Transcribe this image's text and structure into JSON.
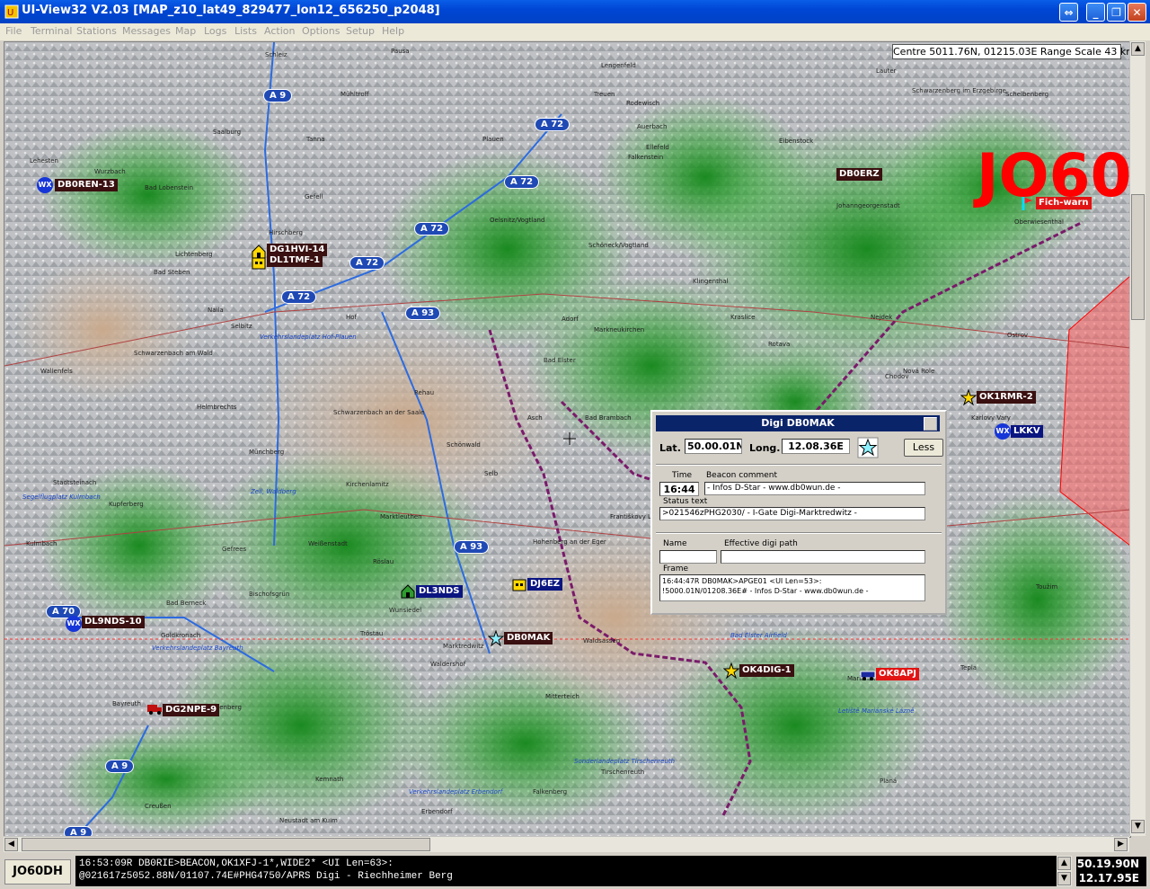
{
  "window": {
    "title": "UI-View32 V2.03 [MAP_z10_lat49_829477_lon12_656250_p2048]"
  },
  "menu": [
    "File",
    "Terminal",
    "Stations",
    "Messages",
    "Map",
    "Logs",
    "Lists",
    "Action",
    "Options",
    "Setup",
    "Help"
  ],
  "map": {
    "info": "Centre 5011.76N, 01215.03E Range Scale 43 km",
    "grid_label": "JO60",
    "roads": [
      "A 9",
      "A 72",
      "A 72",
      "A 72",
      "A 72",
      "A 72",
      "A 93",
      "A 93",
      "A 70",
      "A 9",
      "A 9"
    ],
    "places": [
      "Schleiz",
      "Pausa",
      "Lengenfeld",
      "Rodewisch",
      "Auerbach",
      "Ellefeld",
      "Falkenstein",
      "Plauen",
      "Treuen",
      "Mühltroff",
      "Tanna",
      "Saalburg",
      "Gefell",
      "Hirschberg",
      "Bad Lobenstein",
      "Lehesten",
      "Wurzbach",
      "Lichtenberg",
      "Bad Steben",
      "Naila",
      "Selbitz",
      "Hof",
      "Rehau",
      "Oelsnitz/Vogtland",
      "Schöneck/Vogtland",
      "Adorf",
      "Markneukirchen",
      "Bad Elster",
      "Klingenthal",
      "Eibenstock",
      "Schwarzenberg im Erzgebirge",
      "Schelbenberg",
      "Lauter",
      "Johanngeorgenstadt",
      "Oberwiesenthal",
      "Kraslice",
      "Rotava",
      "Nejdek",
      "Ostrov",
      "Nová Role",
      "Chodov",
      "Karlovy Vary",
      "Schwarzenbach am Wald",
      "Wallenfels",
      "Helmbrechts",
      "Münchberg",
      "Schwarzenbach an der Saale",
      "Stadtsteinach",
      "Kulmbach",
      "Kupferberg",
      "Kirchenlamitz",
      "Marktleuthen",
      "Weißenstadt",
      "Gefrees",
      "Röslau",
      "Wunsiedel",
      "Bischofsgrün",
      "Bad Berneck",
      "Goldkronach",
      "Tröstau",
      "Selb",
      "Schönwald",
      "Asch",
      "Bad Brambach",
      "Hohenberg an der Eger",
      "Františkovy Lázně",
      "Marktredwitz",
      "Waldsassen",
      "Waldershof",
      "Mitterteich",
      "Bayreuth",
      "Weidenberg",
      "Kemnath",
      "Creußen",
      "Neustadt am Kulm",
      "Erbendorf",
      "Falkenberg",
      "Tirschenreuth",
      "Marianske Lazne",
      "Toužim",
      "Tepla",
      "Planá",
      "Verkehrslandeplatz Hof-Plauen",
      "Zell, Waldberg",
      "Verkehrslandeplatz Bayreuth",
      "Sonderlandeplatz Tirschenreuth",
      "Verkehrslandeplatz Erbendorf",
      "Segelflugplatz Kulmbach",
      "Bad Elster Airfield",
      "Letiště Mariánské Lázně"
    ],
    "stations": [
      "DB0REN-13",
      "DG1HVI-14",
      "DL1TMF-1",
      "DB0ERZ",
      "Fich-warn",
      "OK1RMR-2",
      "LKKV",
      "DL3NDS",
      "DJ6EZ",
      "DB0MAK",
      "OK4DIG-1",
      "OK8APJ",
      "DL9NDS-10",
      "DG2NPE-9"
    ],
    "wx_label": "WX"
  },
  "dialog": {
    "title": "Digi  DB0MAK",
    "lat_label": "Lat.",
    "lat_value": "50.00.01N",
    "long_label": "Long.",
    "long_value": "12.08.36E",
    "less_button": "Less",
    "time_label": "Time",
    "time_value": "16:44",
    "beacon_label": "Beacon comment",
    "beacon_value": "- Infos D-Star - www.db0wun.de -",
    "status_label": "Status text",
    "status_value": ">021546zPHG2030/ - I-Gate Digi-Marktredwitz -",
    "name_label": "Name",
    "name_value": "",
    "eff_label": "Effective digi path",
    "eff_value": "",
    "frame_label": "Frame",
    "frame_line1": "16:44:47R DB0MAK>APGE01 <UI Len=53>:",
    "frame_line2": "!5000.01N/01208.36E# - Infos D-Star - www.db0wun.de -"
  },
  "status": {
    "locator": "JO60DH",
    "monitor_line1": "16:53:09R DB0RIE>BEACON,OK1XFJ-1*,WIDE2* <UI Len=63>:",
    "monitor_line2": "@021617z5052.88N/01107.74E#PHG4750/APRS Digi - Riechheimer Berg",
    "lat": "50.19.90N",
    "lon": "12.17.95E"
  }
}
